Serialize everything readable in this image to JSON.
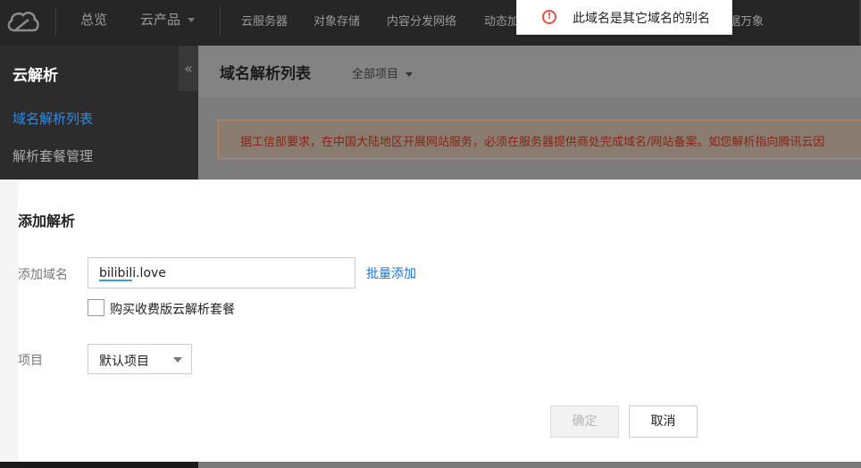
{
  "topnav": {
    "logo_icon": "cloud-logo-icon",
    "items": [
      {
        "label": "总览"
      },
      {
        "label": "云产品"
      }
    ],
    "products": [
      {
        "label": "云服务器"
      },
      {
        "label": "对象存储"
      },
      {
        "label": "内容分发网络"
      },
      {
        "label": "动态加"
      },
      {
        "label": "据万象"
      }
    ]
  },
  "toast": {
    "icon": "error-circle-icon",
    "text": "此域名是其它域名的别名"
  },
  "sidebar": {
    "title": "云解析",
    "collapse_icon": "«",
    "items": [
      {
        "label": "域名解析列表",
        "active": true
      },
      {
        "label": "解析套餐管理",
        "active": false
      }
    ]
  },
  "main": {
    "title": "域名解析列表",
    "project_filter": "全部项目",
    "notice": "据工信部要求，在中国大陆地区开展网站服务，必须在服务器提供商处完成域名/网站备案。如您解析指向腾讯云因"
  },
  "dialog": {
    "title": "添加解析",
    "domain_label": "添加域名",
    "domain_value": "bilibili.love",
    "batch_add": "批量添加",
    "checkbox_label": "购买收费版云解析套餐",
    "project_label": "项目",
    "project_value": "默认项目",
    "ok_label": "确定",
    "cancel_label": "取消"
  },
  "colors": {
    "accent": "#1a73d6",
    "nav_bg": "#262626",
    "error": "#e1504a"
  }
}
